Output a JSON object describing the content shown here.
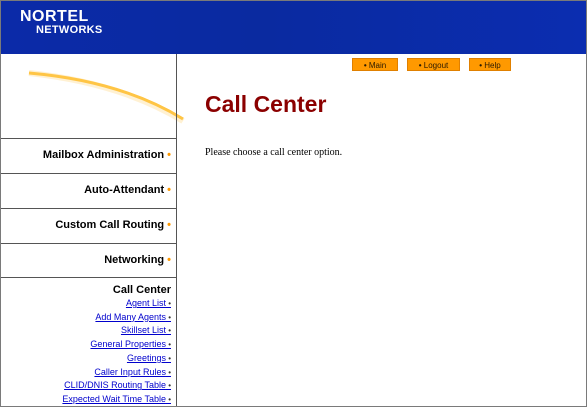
{
  "header": {
    "logo_line1": "NORTEL",
    "logo_line2": "NETWORKS"
  },
  "topnav": [
    {
      "label": "Main"
    },
    {
      "label": "Logout"
    },
    {
      "label": "Help"
    }
  ],
  "sidebar": {
    "items": [
      {
        "label": "Mailbox Administration"
      },
      {
        "label": "Auto-Attendant"
      },
      {
        "label": "Custom Call Routing"
      },
      {
        "label": "Networking"
      }
    ],
    "call_center": {
      "title": "Call Center",
      "links": [
        {
          "label": "Agent List"
        },
        {
          "label": "Add Many Agents"
        },
        {
          "label": "Skillset List"
        },
        {
          "label": "General Properties"
        },
        {
          "label": "Greetings"
        },
        {
          "label": "Caller Input Rules"
        },
        {
          "label": "CLID/DNIS Routing Table"
        },
        {
          "label": "Expected Wait Time Table"
        }
      ]
    }
  },
  "main": {
    "title": "Call Center",
    "instruction": "Please choose a call center option."
  },
  "colors": {
    "header_blue": "#0b2aa8",
    "accent_orange": "#ff9900",
    "title_red": "#8b0000",
    "link_blue": "#0000cc"
  }
}
